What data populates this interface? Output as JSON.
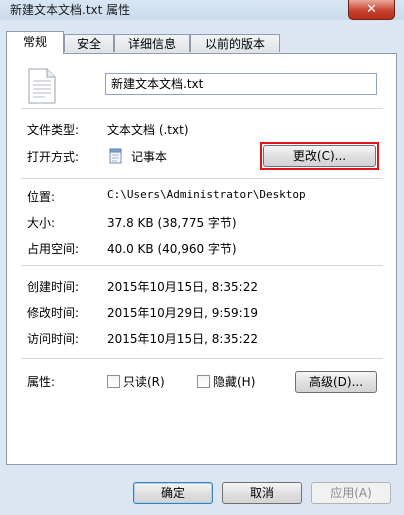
{
  "window": {
    "title": "新建文本文档.txt 属性",
    "close_glyph": "✕"
  },
  "tabs": [
    {
      "label": "常规",
      "active": true
    },
    {
      "label": "安全",
      "active": false
    },
    {
      "label": "详细信息",
      "active": false
    },
    {
      "label": "以前的版本",
      "active": false
    }
  ],
  "general": {
    "filename": "新建文本文档.txt",
    "file_type": {
      "label": "文件类型:",
      "value": "文本文档 (.txt)"
    },
    "opens_with": {
      "label": "打开方式:",
      "value": "记事本",
      "change_button": "更改(C)..."
    },
    "location": {
      "label": "位置:",
      "value": "C:\\Users\\Administrator\\Desktop"
    },
    "size": {
      "label": "大小:",
      "value": "37.8 KB (38,775 字节)"
    },
    "size_on_disk": {
      "label": "占用空间:",
      "value": "40.0 KB (40,960 字节)"
    },
    "created": {
      "label": "创建时间:",
      "value": "2015年10月15日, 8:35:22"
    },
    "modified": {
      "label": "修改时间:",
      "value": "2015年10月29日, 9:59:19"
    },
    "accessed": {
      "label": "访问时间:",
      "value": "2015年10月15日, 8:35:22"
    },
    "attributes": {
      "label": "属性:",
      "readonly": "只读(R)",
      "hidden": "隐藏(H)",
      "advanced_button": "高级(D)..."
    }
  },
  "footer": {
    "ok": "确定",
    "cancel": "取消",
    "apply": "应用(A)"
  },
  "colors": {
    "highlight": "#e0141b",
    "frame": "#dbe6f2"
  }
}
